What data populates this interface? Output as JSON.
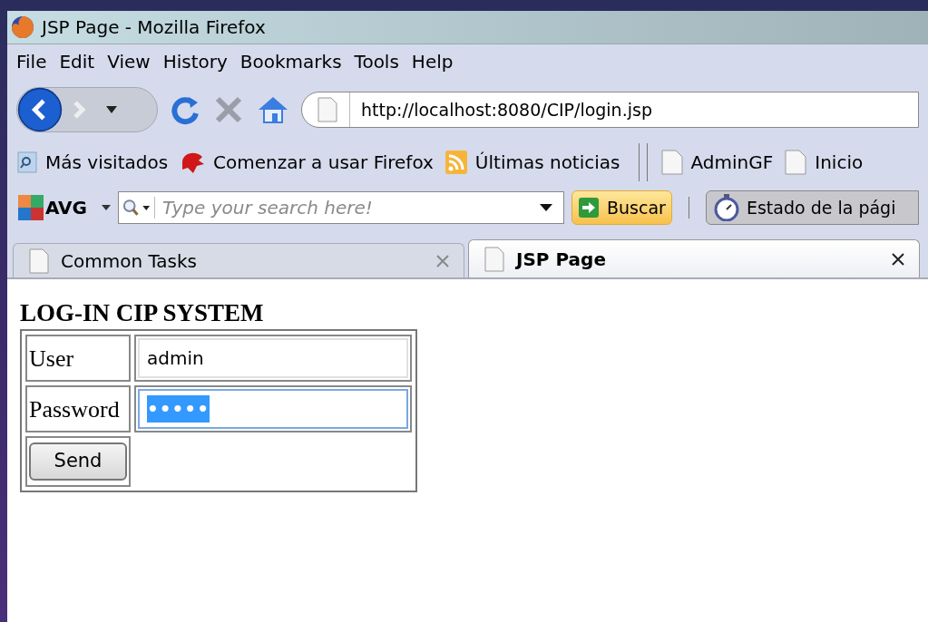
{
  "window": {
    "title": "JSP Page - Mozilla Firefox"
  },
  "menu": [
    "File",
    "Edit",
    "View",
    "History",
    "Bookmarks",
    "Tools",
    "Help"
  ],
  "address": {
    "value": "http://localhost:8080/CIP/login.jsp"
  },
  "bookmarks": [
    {
      "kind": "smart",
      "label": "Más visitados"
    },
    {
      "kind": "dragon",
      "label": "Comenzar a usar Firefox"
    },
    {
      "kind": "feed",
      "label": "Últimas noticias"
    },
    {
      "kind": "separator"
    },
    {
      "kind": "page",
      "label": "AdminGF"
    },
    {
      "kind": "page",
      "label": "Inicio"
    }
  ],
  "avg_toolbar": {
    "logo": "AVG",
    "search_placeholder": "Type your search here!",
    "search_button": "Buscar",
    "status_button": "Estado de la pági"
  },
  "tabs": [
    {
      "label": "Common Tasks",
      "selected": false
    },
    {
      "label": "JSP Page",
      "selected": true
    }
  ],
  "page": {
    "heading": "LOG-IN CIP SYSTEM",
    "fields": [
      {
        "label": "User",
        "value": "admin",
        "kind": "text",
        "focused": false,
        "text_selected": false
      },
      {
        "label": "Password",
        "value": "•••••",
        "kind": "password",
        "focused": true,
        "text_selected": true
      }
    ],
    "button": "Send"
  }
}
